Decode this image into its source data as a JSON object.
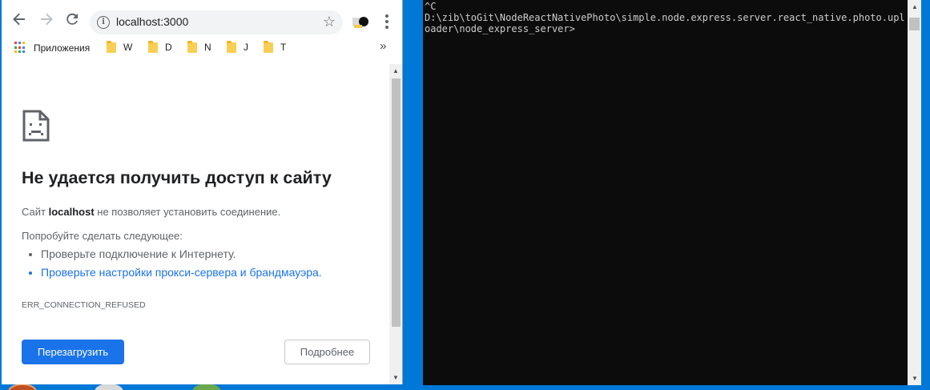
{
  "browser": {
    "url": "localhost:3000",
    "bookmarks_bar": {
      "apps_label": "Приложения",
      "folders": [
        "W",
        "D",
        "N",
        "J",
        "T"
      ],
      "overflow": "»"
    }
  },
  "error_page": {
    "title": "Не удается получить доступ к сайту",
    "description_prefix": "Сайт ",
    "description_host": "localhost",
    "description_suffix": " не позволяет установить соединение.",
    "suggestions_heading": "Попробуйте сделать следующее:",
    "suggestions": [
      "Проверьте подключение к Интернету.",
      "Проверьте настройки прокси-сервера и брандмауэра."
    ],
    "error_code": "ERR_CONNECTION_REFUSED",
    "reload_label": "Перезагрузить",
    "details_label": "Подробнее",
    "colors": {
      "primary_button": "#1a73e8",
      "link": "#1a73e8"
    }
  },
  "console": {
    "lines": [
      "^C",
      "D:\\zib\\toGit\\NodeReactNativePhoto\\simple.node.express.server.react_native.photo.uploader\\node_express_server>"
    ],
    "colors": {
      "background": "#0c0c0c",
      "text": "#cccccc"
    }
  },
  "desktop": {
    "background": "#0078d7"
  }
}
